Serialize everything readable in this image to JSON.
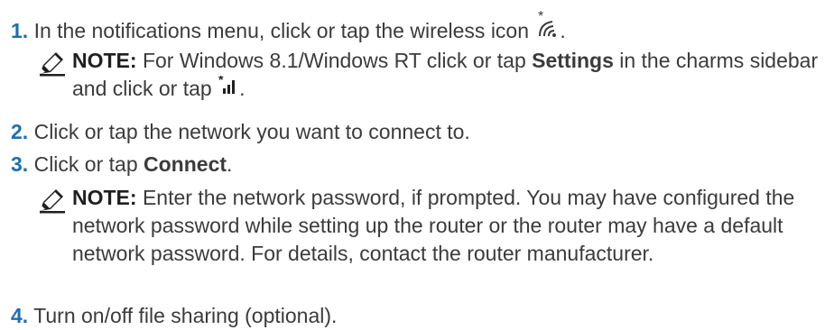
{
  "steps": [
    {
      "number": "1.",
      "text": "In the notifications menu, click or tap the wireless icon",
      "icon": "wireless-icon",
      "suffix": "."
    },
    {
      "number": "2.",
      "text": "Click or tap the network you want to connect to."
    },
    {
      "number": "3.",
      "text_before": "Click or tap ",
      "bold": "Connect",
      "suffix": "."
    },
    {
      "number": "4.",
      "text": "Turn on/off file sharing (optional)."
    }
  ],
  "notes": [
    {
      "label": "NOTE:",
      "text_before": " For Windows 8.1/Windows RT click or tap ",
      "bold": "Settings",
      "text_after": " in the charms sidebar and click or tap ",
      "icon": "wireless-signal-icon",
      "suffix": "."
    },
    {
      "label": "NOTE:",
      "text": " Enter the network password, if prompted. You may have configured the network password while setting up the router or the router may have a default network password. For details, contact the router manufacturer."
    }
  ],
  "colors": {
    "step_number": "#1e6fb3",
    "note_icon": "#1f1f1f",
    "body_text": "#3b3b3b"
  }
}
